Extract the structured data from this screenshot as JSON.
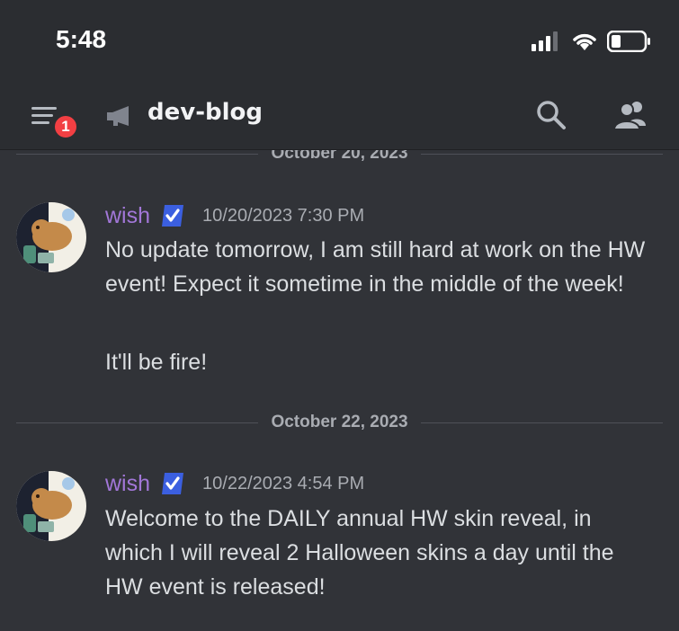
{
  "status_bar": {
    "time": "5:48"
  },
  "header": {
    "channel_name": "dev-blog",
    "notification_count": "1",
    "icons": {
      "menu": "hamburger-menu-icon",
      "channel": "announcement-megaphone-icon",
      "search": "search-icon",
      "members": "members-icon"
    }
  },
  "messages": {
    "top_divider": "October 20, 2023",
    "middle_divider": "October 22, 2023",
    "items": [
      {
        "author": "wish",
        "timestamp": "10/20/2023 7:30 PM",
        "lines": [
          "No update tomorrow, I am still hard at work on the HW event! Expect it sometime in the middle of the week!",
          "It'll be fire!"
        ]
      },
      {
        "author": "wish",
        "timestamp": "10/22/2023 4:54 PM",
        "lines": [
          "Welcome to the DAILY annual HW skin reveal, in which I will reveal 2 Halloween skins a day until the HW event is released!"
        ]
      }
    ]
  },
  "colors": {
    "background": "#313338",
    "header": "#2b2d31",
    "author": "#a277d8",
    "verified": "#3b5fe0",
    "badge": "#f23f43"
  }
}
